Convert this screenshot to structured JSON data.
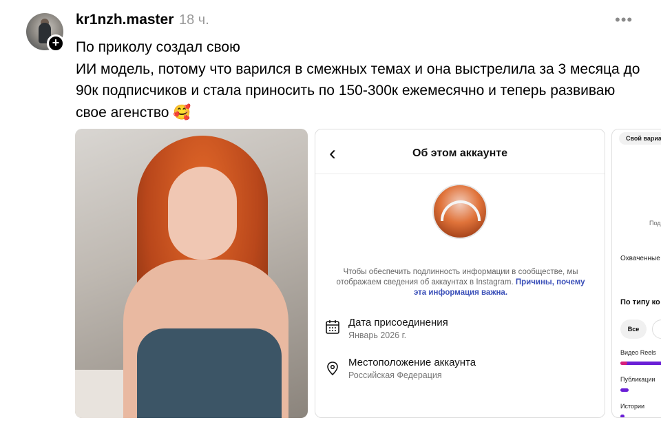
{
  "post": {
    "username": "kr1nzh.master",
    "time": "18 ч.",
    "more_label": "•••",
    "plus_label": "+",
    "text": "По приколу создал свою\nИИ модель, потому что варился в смежных темах и она выстрелила за 3 месяца до 90к подписчиков и стала приносить по 150-300к ежемесячно и теперь развиваю свое агенство 🥰"
  },
  "about_card": {
    "back_label": "‹",
    "title": "Об этом аккаунте",
    "info_text": "Чтобы обеспечить подлинность информации в сообществе, мы отображаем сведения об аккаунтах в Instagram.",
    "info_link": "Причины, почему эта информация важна.",
    "rows": [
      {
        "icon": "calendar-icon",
        "label": "Дата присоединения",
        "value": "Январь 2026 г."
      },
      {
        "icon": "location-pin-icon",
        "label": "Местоположение аккаунта",
        "value": "Российская Федерация"
      }
    ]
  },
  "stats_card": {
    "pill": "Свой вариа",
    "pod": "Под",
    "reached": "Охваченные",
    "by_type": "По типу ко",
    "chip_all": "Все",
    "reels": "Видео Reels",
    "posts": "Публикации",
    "stories": "Истории",
    "colors": {
      "bar_primary": "#6a1fd6",
      "bar_accent": "#d6207a",
      "bar_track": "#e9e2f7"
    }
  }
}
